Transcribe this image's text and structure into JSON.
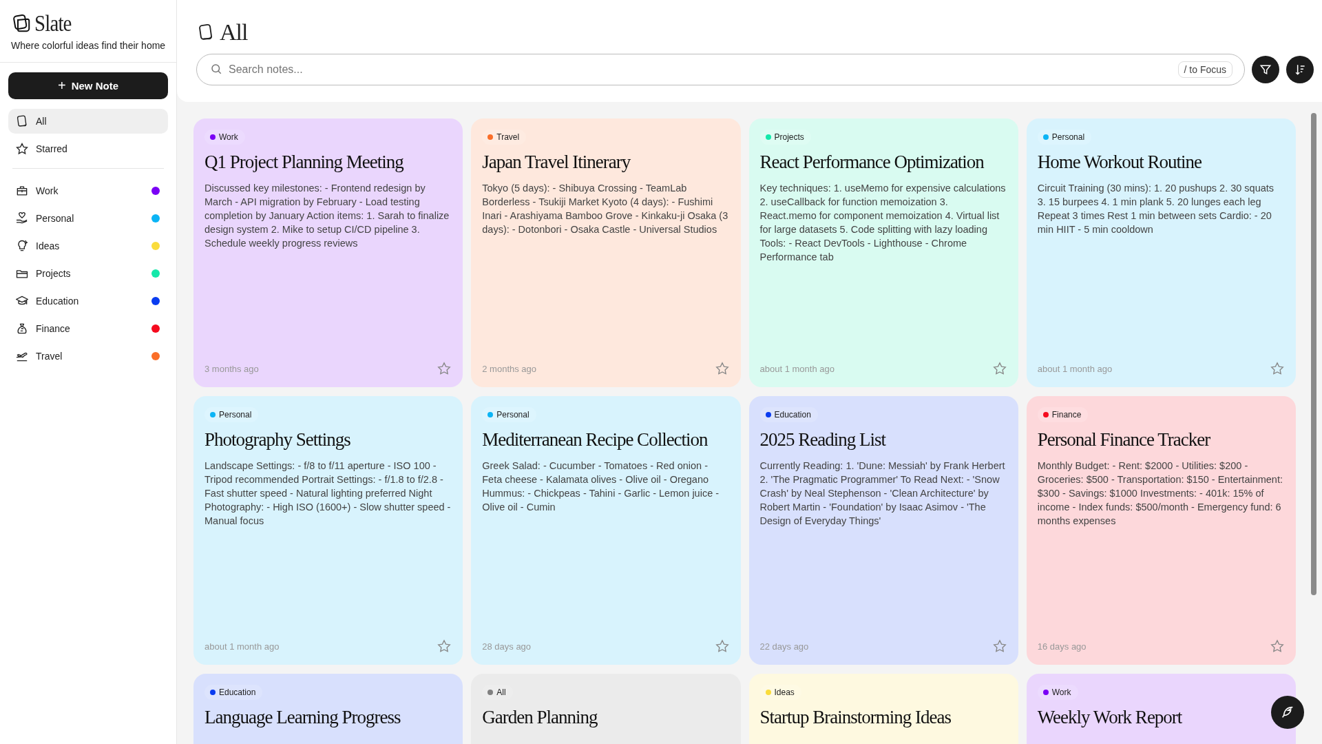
{
  "sidebar": {
    "logo": "Slate",
    "tagline": "Where colorful ideas find their home",
    "new_note_button": {
      "icon": "+",
      "label": "New Note"
    },
    "views": [
      {
        "label": "All",
        "selected": true
      },
      {
        "label": "Starred",
        "selected": false
      }
    ],
    "categories": [
      {
        "label": "Work",
        "color": "#7a00f5"
      },
      {
        "label": "Personal",
        "color": "#0bb4f5"
      },
      {
        "label": "Ideas",
        "color": "#fadc3c"
      },
      {
        "label": "Projects",
        "color": "#14e8aa"
      },
      {
        "label": "Education",
        "color": "#0a3cf0"
      },
      {
        "label": "Finance",
        "color": "#f50a1e"
      },
      {
        "label": "Travel",
        "color": "#fa6e28"
      }
    ]
  },
  "header": {
    "title": "All",
    "search": {
      "placeholder": "Search notes...",
      "shortcut": "/ to Focus"
    }
  },
  "notes": [
    {
      "tag": "Work",
      "color": "#7a00f5",
      "title": "Q1 Project Planning Meeting",
      "body": "Discussed key milestones: - Frontend redesign by March - API migration by February - Load testing completion by January Action items: 1. Sarah to finalize design system 2. Mike to setup CI/CD pipeline 3. Schedule weekly progress reviews",
      "time": "3 months ago",
      "starred": false
    },
    {
      "tag": "Travel",
      "color": "#fa6e28",
      "title": "Japan Travel Itinerary",
      "body": "Tokyo (5 days): - Shibuya Crossing - TeamLab Borderless - Tsukiji Market Kyoto (4 days): - Fushimi Inari - Arashiyama Bamboo Grove - Kinkaku-ji Osaka (3 days): - Dotonbori - Osaka Castle - Universal Studios",
      "time": "2 months ago",
      "starred": false
    },
    {
      "tag": "Projects",
      "color": "#14e8aa",
      "title": "React Performance Optimization",
      "body": "Key techniques: 1. useMemo for expensive calculations 2. useCallback for function memoization 3. React.memo for component memoization 4. Virtual list for large datasets 5. Code splitting with lazy loading Tools: - React DevTools - Lighthouse - Chrome Performance tab",
      "time": "about 1 month ago",
      "starred": false
    },
    {
      "tag": "Personal",
      "color": "#0bb4f5",
      "title": "Home Workout Routine",
      "body": "Circuit Training (30 mins): 1. 20 pushups 2. 30 squats 3. 15 burpees 4. 1 min plank 5. 20 lunges each leg Repeat 3 times Rest 1 min between sets Cardio: - 20 min HIIT - 5 min cooldown",
      "time": "about 1 month ago",
      "starred": false
    },
    {
      "tag": "Personal",
      "color": "#0bb4f5",
      "title": "Photography Settings",
      "body": "Landscape Settings: - f/8 to f/11 aperture - ISO 100 - Tripod recommended Portrait Settings: - f/1.8 to f/2.8 - Fast shutter speed - Natural lighting preferred Night Photography: - High ISO (1600+) - Slow shutter speed - Manual focus",
      "time": "about 1 month ago",
      "starred": false
    },
    {
      "tag": "Personal",
      "color": "#0bb4f5",
      "title": "Mediterranean Recipe Collection",
      "body": "Greek Salad: - Cucumber - Tomatoes - Red onion - Feta cheese - Kalamata olives - Olive oil - Oregano Hummus: - Chickpeas - Tahini - Garlic - Lemon juice - Olive oil - Cumin",
      "time": "28 days ago",
      "starred": false
    },
    {
      "tag": "Education",
      "color": "#0a3cf0",
      "title": "2025 Reading List",
      "body": "Currently Reading: 1. 'Dune: Messiah' by Frank Herbert 2. 'The Pragmatic Programmer' To Read Next: - 'Snow Crash' by Neal Stephenson - 'Clean Architecture' by Robert Martin - 'Foundation' by Isaac Asimov - 'The Design of Everyday Things'",
      "time": "22 days ago",
      "starred": false
    },
    {
      "tag": "Finance",
      "color": "#f50a1e",
      "title": "Personal Finance Tracker",
      "body": "Monthly Budget: - Rent: $2000 - Utilities: $200 - Groceries: $500 - Transportation: $150 - Entertainment: $300 - Savings: $1000 Investments: - 401k: 15% of income - Index funds: $500/month - Emergency fund: 6 months expenses",
      "time": "16 days ago",
      "starred": false
    },
    {
      "tag": "Education",
      "color": "#0a3cf0",
      "title": "Language Learning Progress"
    },
    {
      "tag": "All",
      "color": "#808080",
      "title": "Garden Planning"
    },
    {
      "tag": "Ideas",
      "color": "#fadc3c",
      "title": "Startup Brainstorming Ideas"
    },
    {
      "tag": "Work",
      "color": "#7a00f5",
      "title": "Weekly Work Report"
    }
  ]
}
